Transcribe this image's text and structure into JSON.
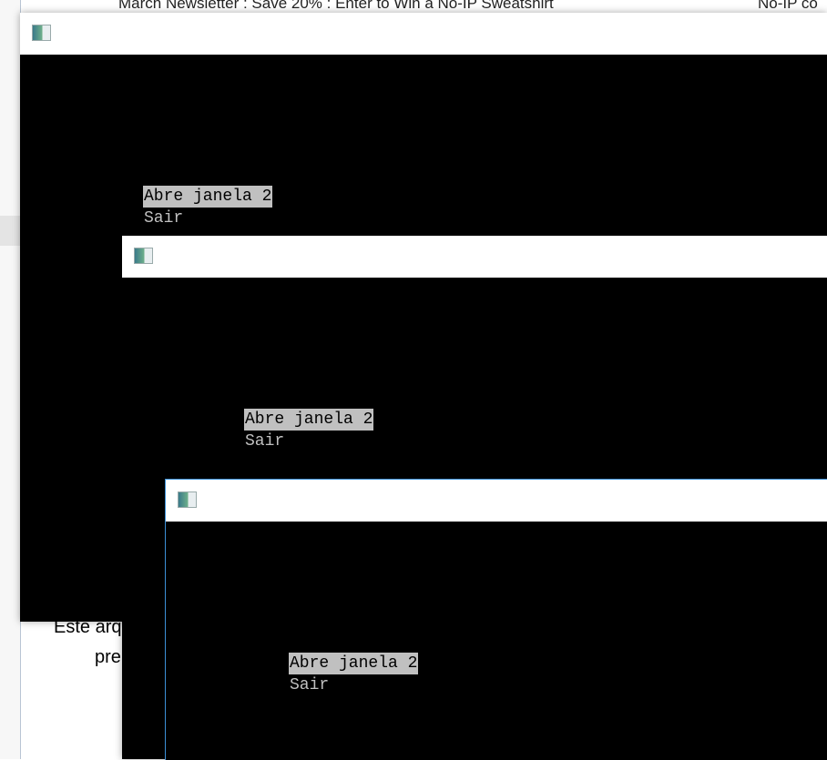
{
  "background": {
    "tab_title": "March Newsletter : Save 20% : Enter to Win a No-IP Sweatshirt",
    "tab_title_right": "No-IP co",
    "doc_line1": "Este arq",
    "doc_line2": "pre"
  },
  "windows": [
    {
      "icon": "console-app-icon",
      "menu": [
        "Abre janela 2",
        "Sair"
      ],
      "selected": 0
    },
    {
      "icon": "console-app-icon",
      "menu": [
        "Abre janela 2",
        "Sair"
      ],
      "selected": 0
    },
    {
      "icon": "console-app-icon",
      "menu": [
        "Abre janela 2",
        "Sair"
      ],
      "selected": 0
    }
  ]
}
